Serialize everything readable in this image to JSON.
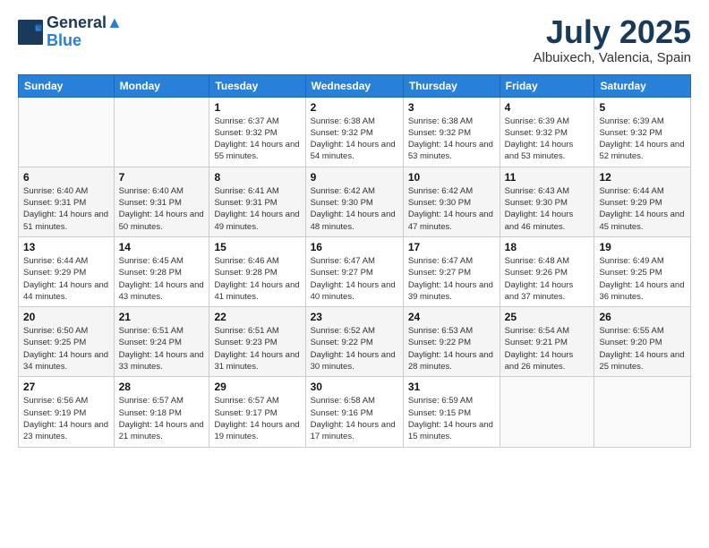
{
  "logo": {
    "line1": "General",
    "line2": "Blue"
  },
  "title": "July 2025",
  "subtitle": "Albuixech, Valencia, Spain",
  "weekdays": [
    "Sunday",
    "Monday",
    "Tuesday",
    "Wednesday",
    "Thursday",
    "Friday",
    "Saturday"
  ],
  "weeks": [
    [
      {
        "day": "",
        "sunrise": "",
        "sunset": "",
        "daylight": ""
      },
      {
        "day": "",
        "sunrise": "",
        "sunset": "",
        "daylight": ""
      },
      {
        "day": "1",
        "sunrise": "Sunrise: 6:37 AM",
        "sunset": "Sunset: 9:32 PM",
        "daylight": "Daylight: 14 hours and 55 minutes."
      },
      {
        "day": "2",
        "sunrise": "Sunrise: 6:38 AM",
        "sunset": "Sunset: 9:32 PM",
        "daylight": "Daylight: 14 hours and 54 minutes."
      },
      {
        "day": "3",
        "sunrise": "Sunrise: 6:38 AM",
        "sunset": "Sunset: 9:32 PM",
        "daylight": "Daylight: 14 hours and 53 minutes."
      },
      {
        "day": "4",
        "sunrise": "Sunrise: 6:39 AM",
        "sunset": "Sunset: 9:32 PM",
        "daylight": "Daylight: 14 hours and 53 minutes."
      },
      {
        "day": "5",
        "sunrise": "Sunrise: 6:39 AM",
        "sunset": "Sunset: 9:32 PM",
        "daylight": "Daylight: 14 hours and 52 minutes."
      }
    ],
    [
      {
        "day": "6",
        "sunrise": "Sunrise: 6:40 AM",
        "sunset": "Sunset: 9:31 PM",
        "daylight": "Daylight: 14 hours and 51 minutes."
      },
      {
        "day": "7",
        "sunrise": "Sunrise: 6:40 AM",
        "sunset": "Sunset: 9:31 PM",
        "daylight": "Daylight: 14 hours and 50 minutes."
      },
      {
        "day": "8",
        "sunrise": "Sunrise: 6:41 AM",
        "sunset": "Sunset: 9:31 PM",
        "daylight": "Daylight: 14 hours and 49 minutes."
      },
      {
        "day": "9",
        "sunrise": "Sunrise: 6:42 AM",
        "sunset": "Sunset: 9:30 PM",
        "daylight": "Daylight: 14 hours and 48 minutes."
      },
      {
        "day": "10",
        "sunrise": "Sunrise: 6:42 AM",
        "sunset": "Sunset: 9:30 PM",
        "daylight": "Daylight: 14 hours and 47 minutes."
      },
      {
        "day": "11",
        "sunrise": "Sunrise: 6:43 AM",
        "sunset": "Sunset: 9:30 PM",
        "daylight": "Daylight: 14 hours and 46 minutes."
      },
      {
        "day": "12",
        "sunrise": "Sunrise: 6:44 AM",
        "sunset": "Sunset: 9:29 PM",
        "daylight": "Daylight: 14 hours and 45 minutes."
      }
    ],
    [
      {
        "day": "13",
        "sunrise": "Sunrise: 6:44 AM",
        "sunset": "Sunset: 9:29 PM",
        "daylight": "Daylight: 14 hours and 44 minutes."
      },
      {
        "day": "14",
        "sunrise": "Sunrise: 6:45 AM",
        "sunset": "Sunset: 9:28 PM",
        "daylight": "Daylight: 14 hours and 43 minutes."
      },
      {
        "day": "15",
        "sunrise": "Sunrise: 6:46 AM",
        "sunset": "Sunset: 9:28 PM",
        "daylight": "Daylight: 14 hours and 41 minutes."
      },
      {
        "day": "16",
        "sunrise": "Sunrise: 6:47 AM",
        "sunset": "Sunset: 9:27 PM",
        "daylight": "Daylight: 14 hours and 40 minutes."
      },
      {
        "day": "17",
        "sunrise": "Sunrise: 6:47 AM",
        "sunset": "Sunset: 9:27 PM",
        "daylight": "Daylight: 14 hours and 39 minutes."
      },
      {
        "day": "18",
        "sunrise": "Sunrise: 6:48 AM",
        "sunset": "Sunset: 9:26 PM",
        "daylight": "Daylight: 14 hours and 37 minutes."
      },
      {
        "day": "19",
        "sunrise": "Sunrise: 6:49 AM",
        "sunset": "Sunset: 9:25 PM",
        "daylight": "Daylight: 14 hours and 36 minutes."
      }
    ],
    [
      {
        "day": "20",
        "sunrise": "Sunrise: 6:50 AM",
        "sunset": "Sunset: 9:25 PM",
        "daylight": "Daylight: 14 hours and 34 minutes."
      },
      {
        "day": "21",
        "sunrise": "Sunrise: 6:51 AM",
        "sunset": "Sunset: 9:24 PM",
        "daylight": "Daylight: 14 hours and 33 minutes."
      },
      {
        "day": "22",
        "sunrise": "Sunrise: 6:51 AM",
        "sunset": "Sunset: 9:23 PM",
        "daylight": "Daylight: 14 hours and 31 minutes."
      },
      {
        "day": "23",
        "sunrise": "Sunrise: 6:52 AM",
        "sunset": "Sunset: 9:22 PM",
        "daylight": "Daylight: 14 hours and 30 minutes."
      },
      {
        "day": "24",
        "sunrise": "Sunrise: 6:53 AM",
        "sunset": "Sunset: 9:22 PM",
        "daylight": "Daylight: 14 hours and 28 minutes."
      },
      {
        "day": "25",
        "sunrise": "Sunrise: 6:54 AM",
        "sunset": "Sunset: 9:21 PM",
        "daylight": "Daylight: 14 hours and 26 minutes."
      },
      {
        "day": "26",
        "sunrise": "Sunrise: 6:55 AM",
        "sunset": "Sunset: 9:20 PM",
        "daylight": "Daylight: 14 hours and 25 minutes."
      }
    ],
    [
      {
        "day": "27",
        "sunrise": "Sunrise: 6:56 AM",
        "sunset": "Sunset: 9:19 PM",
        "daylight": "Daylight: 14 hours and 23 minutes."
      },
      {
        "day": "28",
        "sunrise": "Sunrise: 6:57 AM",
        "sunset": "Sunset: 9:18 PM",
        "daylight": "Daylight: 14 hours and 21 minutes."
      },
      {
        "day": "29",
        "sunrise": "Sunrise: 6:57 AM",
        "sunset": "Sunset: 9:17 PM",
        "daylight": "Daylight: 14 hours and 19 minutes."
      },
      {
        "day": "30",
        "sunrise": "Sunrise: 6:58 AM",
        "sunset": "Sunset: 9:16 PM",
        "daylight": "Daylight: 14 hours and 17 minutes."
      },
      {
        "day": "31",
        "sunrise": "Sunrise: 6:59 AM",
        "sunset": "Sunset: 9:15 PM",
        "daylight": "Daylight: 14 hours and 15 minutes."
      },
      {
        "day": "",
        "sunrise": "",
        "sunset": "",
        "daylight": ""
      },
      {
        "day": "",
        "sunrise": "",
        "sunset": "",
        "daylight": ""
      }
    ]
  ]
}
